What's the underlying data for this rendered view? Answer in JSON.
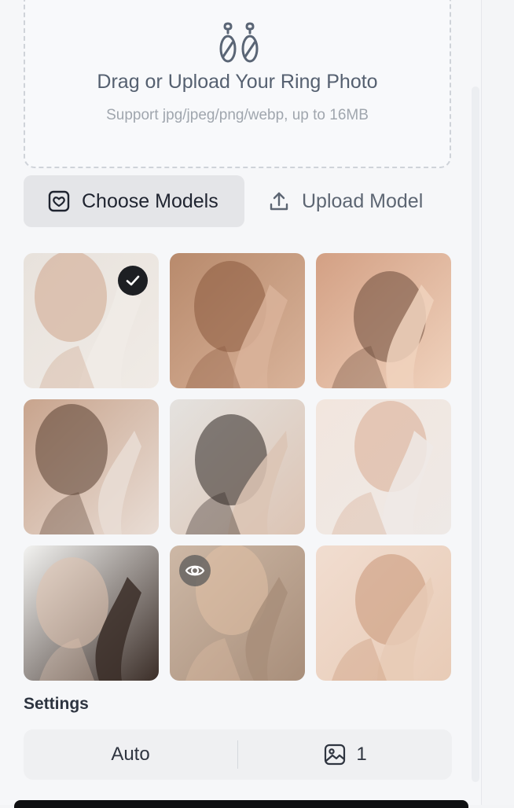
{
  "upload": {
    "title": "Drag or Upload Your Ring Photo",
    "subtitle": "Support jpg/jpeg/png/webp, up to 16MB",
    "icon": "earrings-icon"
  },
  "model_tabs": [
    {
      "label": "Choose Models",
      "icon": "model-frame-icon",
      "active": true
    },
    {
      "label": "Upload Model",
      "icon": "upload-icon",
      "active": false
    }
  ],
  "models": {
    "selected_index": 0,
    "hover_index": 7,
    "items": [
      {
        "name": "model-photo-1",
        "palette": [
          "#e8e2dc",
          "#cfa58c",
          "#f0ebe6"
        ]
      },
      {
        "name": "model-photo-2",
        "palette": [
          "#b88a6c",
          "#8a5a3e",
          "#d9b39a"
        ]
      },
      {
        "name": "model-photo-3",
        "palette": [
          "#d3a084",
          "#6b4a3a",
          "#f0d2bd"
        ]
      },
      {
        "name": "model-photo-4",
        "palette": [
          "#c8a48d",
          "#5a3f31",
          "#e9ddd5"
        ]
      },
      {
        "name": "model-photo-5",
        "palette": [
          "#e4e2df",
          "#2d2622",
          "#dcc4b4"
        ]
      },
      {
        "name": "model-photo-6",
        "palette": [
          "#f2e6de",
          "#d8ab92",
          "#eee9e6"
        ]
      },
      {
        "name": "model-photo-7",
        "palette": [
          "#f3f3f1",
          "#e0c2ae",
          "#3b2e28"
        ]
      },
      {
        "name": "model-photo-8",
        "palette": [
          "#cdb8a6",
          "#e2c1a6",
          "#a88e7a"
        ]
      },
      {
        "name": "model-photo-9",
        "palette": [
          "#f1ddd0",
          "#c99676",
          "#e8cbb6"
        ]
      }
    ]
  },
  "settings": {
    "label": "Settings",
    "mode_value": "Auto",
    "count_icon": "image-icon",
    "count_value": "1"
  }
}
